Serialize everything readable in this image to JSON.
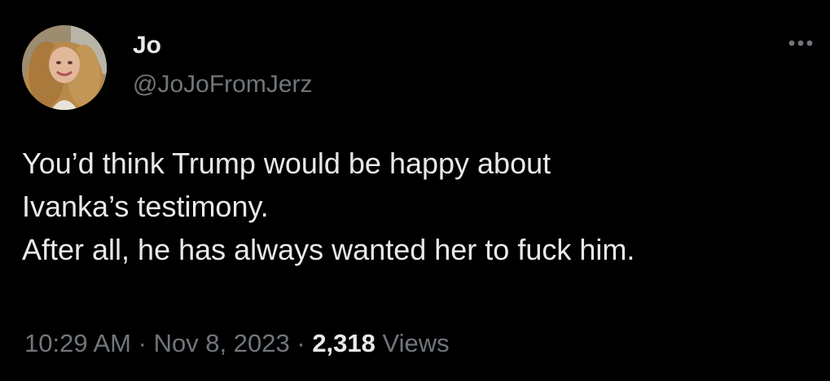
{
  "author": {
    "display_name": "Jo",
    "handle": "@JoJoFromJerz",
    "avatar_icon": "profile-photo"
  },
  "more_icon": "ellipsis-icon",
  "tweet": {
    "lines": [
      "You’d think Trump would be happy about",
      "Ivanka’s testimony.",
      "After all, he has always wanted her to fuck him."
    ]
  },
  "meta": {
    "time": "10:29 AM",
    "separator": "·",
    "date": "Nov 8, 2023",
    "views_count": "2,318",
    "views_label": "Views"
  },
  "colors": {
    "background": "#000000",
    "primary_text": "#e7e9ea",
    "secondary_text": "#71767b"
  }
}
